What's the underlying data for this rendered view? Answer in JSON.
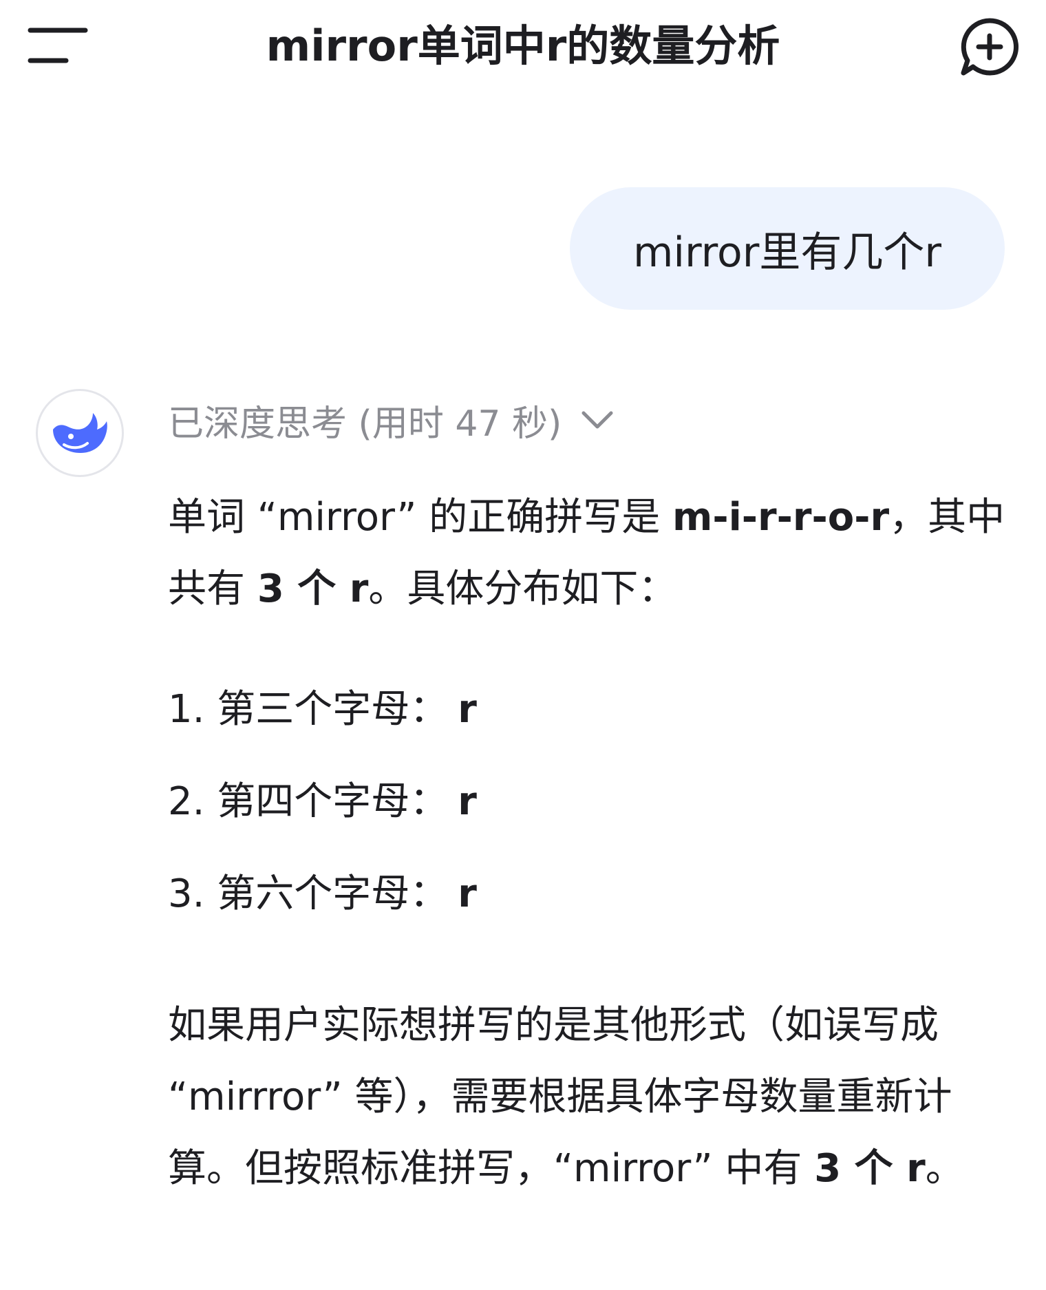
{
  "header": {
    "title": "mirror单词中r的数量分析",
    "menu_icon": "menu-icon",
    "new_chat_icon": "new-chat-icon"
  },
  "conversation": {
    "user_message": "mirror里有几个r",
    "assistant": {
      "avatar_icon": "deepseek-whale-logo",
      "thinking_status": "已深度思考 (用时 47 秒)",
      "expand_icon": "chevron-down-icon",
      "intro_prefix": "单词 “mirror” 的正确拼写是 ",
      "intro_spelling": "m-i-r-r-o-r",
      "intro_middle": "，其中共有 ",
      "intro_count": "3 个 r",
      "intro_suffix": "。具体分布如下：",
      "list": [
        {
          "label": "1. 第三个字母：",
          "value": "r"
        },
        {
          "label": "2. 第四个字母：",
          "value": "r"
        },
        {
          "label": "3. 第六个字母：",
          "value": "r"
        }
      ],
      "conclusion_prefix": "如果用户实际想拼写的是其他形式（如误写成 “mirrror” 等），需要根据具体字母数量重新计算。但按照标准拼写，“mirror” 中有 ",
      "conclusion_count": "3 个 r",
      "conclusion_suffix": "。"
    }
  },
  "colors": {
    "user_bubble_bg": "#edf3fe",
    "brand_blue": "#4d6bfe",
    "muted_text": "#8b8c92"
  }
}
